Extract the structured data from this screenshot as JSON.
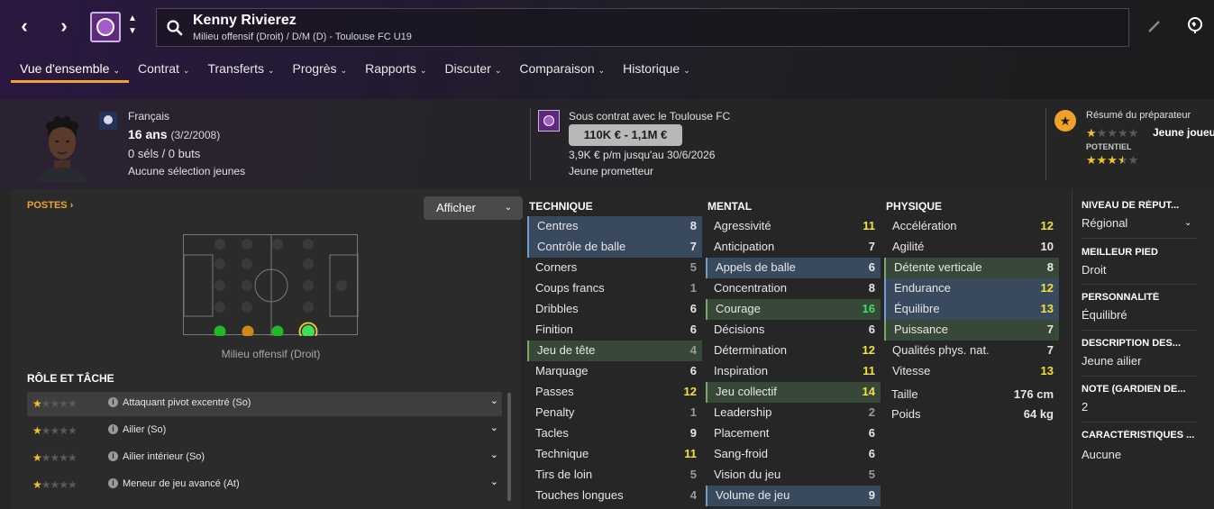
{
  "header": {
    "player_name": "Kenny Rivierez",
    "player_subtitle": "Milieu offensif (Droit) / D/M (D) - Toulouse FC U19",
    "nav_back": "‹",
    "nav_forward": "›"
  },
  "tabs": [
    {
      "label": "Vue d'ensemble"
    },
    {
      "label": "Contrat"
    },
    {
      "label": "Transferts"
    },
    {
      "label": "Progrès"
    },
    {
      "label": "Rapports"
    },
    {
      "label": "Discuter"
    },
    {
      "label": "Comparaison"
    },
    {
      "label": "Historique"
    }
  ],
  "profile": {
    "nationality": "Français",
    "age": "16 ans",
    "dob": "(3/2/2008)",
    "caps": "0 séls / 0 buts",
    "youth_caps": "Aucune sélection jeunes"
  },
  "contract": {
    "club_line": "Sous contrat avec le Toulouse FC",
    "value_range": "110K € - 1,1M €",
    "wage_line": "3,9K € p/m jusqu'au 30/6/2026",
    "status": "Jeune prometteur"
  },
  "trainer": {
    "label": "Résumé du préparateur",
    "current_stars": 1,
    "current_value": "Jeune joueur",
    "potential_label": "POTENTIEL",
    "potential_stars": 3.5
  },
  "positions": {
    "title": "POSTES ›",
    "show_button": "Afficher",
    "position_caption": "Milieu offensif (Droit)"
  },
  "roles": {
    "title": "RÔLE ET TÂCHE",
    "items": [
      {
        "name": "Attaquant pivot excentré (So)",
        "stars": 1,
        "selected": true
      },
      {
        "name": "Ailier (So)",
        "stars": 1,
        "selected": false
      },
      {
        "name": "Ailier intérieur (So)",
        "stars": 1,
        "selected": false
      },
      {
        "name": "Meneur de jeu avancé (At)",
        "stars": 1,
        "selected": false
      }
    ]
  },
  "attributes": {
    "technique": {
      "title": "TECHNIQUE",
      "rows": [
        {
          "name": "Centres",
          "value": "8",
          "hl": "blue"
        },
        {
          "name": "Contrôle de balle",
          "value": "7",
          "hl": "blue"
        },
        {
          "name": "Corners",
          "value": "5",
          "hl": ""
        },
        {
          "name": "Coups francs",
          "value": "1",
          "hl": ""
        },
        {
          "name": "Dribbles",
          "value": "6",
          "hl": ""
        },
        {
          "name": "Finition",
          "value": "6",
          "hl": ""
        },
        {
          "name": "Jeu de tête",
          "value": "4",
          "hl": "green"
        },
        {
          "name": "Marquage",
          "value": "6",
          "hl": ""
        },
        {
          "name": "Passes",
          "value": "12",
          "hl": ""
        },
        {
          "name": "Penalty",
          "value": "1",
          "hl": ""
        },
        {
          "name": "Tacles",
          "value": "9",
          "hl": ""
        },
        {
          "name": "Technique",
          "value": "11",
          "hl": ""
        },
        {
          "name": "Tirs de loin",
          "value": "5",
          "hl": ""
        },
        {
          "name": "Touches longues",
          "value": "4",
          "hl": ""
        }
      ]
    },
    "mental": {
      "title": "MENTAL",
      "rows": [
        {
          "name": "Agressivité",
          "value": "11",
          "hl": ""
        },
        {
          "name": "Anticipation",
          "value": "7",
          "hl": ""
        },
        {
          "name": "Appels de balle",
          "value": "6",
          "hl": "blue"
        },
        {
          "name": "Concentration",
          "value": "8",
          "hl": ""
        },
        {
          "name": "Courage",
          "value": "16",
          "hl": "green"
        },
        {
          "name": "Décisions",
          "value": "6",
          "hl": ""
        },
        {
          "name": "Détermination",
          "value": "12",
          "hl": ""
        },
        {
          "name": "Inspiration",
          "value": "11",
          "hl": ""
        },
        {
          "name": "Jeu collectif",
          "value": "14",
          "hl": "green"
        },
        {
          "name": "Leadership",
          "value": "2",
          "hl": ""
        },
        {
          "name": "Placement",
          "value": "6",
          "hl": ""
        },
        {
          "name": "Sang-froid",
          "value": "6",
          "hl": ""
        },
        {
          "name": "Vision du jeu",
          "value": "5",
          "hl": ""
        },
        {
          "name": "Volume de jeu",
          "value": "9",
          "hl": "blue"
        }
      ]
    },
    "physique": {
      "title": "PHYSIQUE",
      "rows": [
        {
          "name": "Accélération",
          "value": "12",
          "hl": ""
        },
        {
          "name": "Agilité",
          "value": "10",
          "hl": ""
        },
        {
          "name": "Détente verticale",
          "value": "8",
          "hl": "green"
        },
        {
          "name": "Endurance",
          "value": "12",
          "hl": "blue"
        },
        {
          "name": "Équilibre",
          "value": "13",
          "hl": "blue"
        },
        {
          "name": "Puissance",
          "value": "7",
          "hl": "green"
        },
        {
          "name": "Qualités phys. nat.",
          "value": "7",
          "hl": ""
        },
        {
          "name": "Vitesse",
          "value": "13",
          "hl": ""
        }
      ],
      "height_label": "Taille",
      "height_value": "176 cm",
      "weight_label": "Poids",
      "weight_value": "64 kg"
    }
  },
  "side_info": {
    "reputation_label": "NIVEAU DE RÉPUT...",
    "reputation_value": "Régional",
    "foot_label": "MEILLEUR PIED",
    "foot_value": "Droit",
    "personality_label": "PERSONNALITÉ",
    "personality_value": "Équilibré",
    "description_label": "DESCRIPTION DES...",
    "description_value": "Jeune ailier",
    "gk_label": "NOTE (GARDIEN DE...",
    "gk_value": "2",
    "traits_label": "CARACTÉRISTIQUES ...",
    "traits_value": "Aucune"
  },
  "colors": {
    "accent": "#f0a22a",
    "attr_good": "#f2e23a",
    "attr_great": "#3fe06a",
    "attr_low": "#9a9a9a"
  }
}
